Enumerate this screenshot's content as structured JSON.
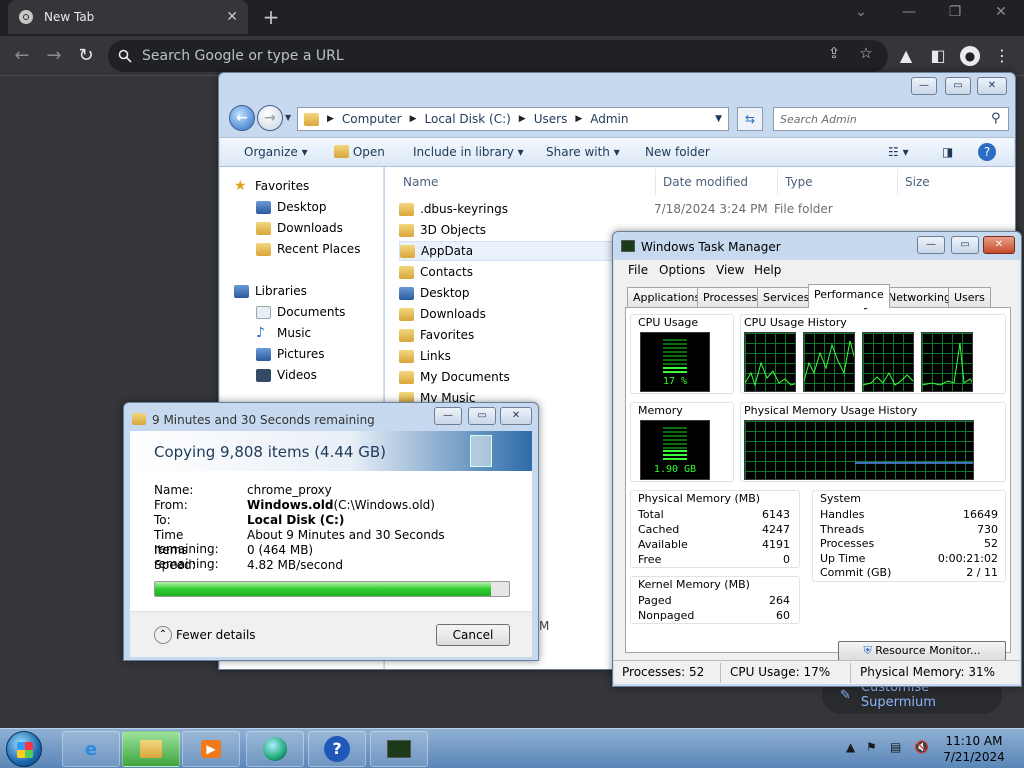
{
  "chrome": {
    "tab_title": "New Tab",
    "omnibox_placeholder": "Search Google or type a URL",
    "customise_label": "Customise Supermium"
  },
  "explorer": {
    "breadcrumb": [
      "Computer",
      "Local Disk (C:)",
      "Users",
      "Admin"
    ],
    "search_placeholder": "Search Admin",
    "commands": {
      "organize": "Organize",
      "open": "Open",
      "include": "Include in library",
      "share": "Share with",
      "new_folder": "New folder"
    },
    "nav": {
      "favorites": "Favorites",
      "fav_items": [
        "Desktop",
        "Downloads",
        "Recent Places"
      ],
      "libraries": "Libraries",
      "lib_items": [
        "Documents",
        "Music",
        "Pictures",
        "Videos"
      ]
    },
    "columns": {
      "name": "Name",
      "date": "Date modified",
      "type": "Type",
      "size": "Size"
    },
    "files": [
      {
        "name": ".dbus-keyrings",
        "date": "7/18/2024 3:24 PM",
        "type": "File folder"
      },
      {
        "name": "3D Objects",
        "date": "",
        "type": ""
      },
      {
        "name": "AppData",
        "date": "",
        "type": ""
      },
      {
        "name": "Contacts",
        "date": "",
        "type": ""
      },
      {
        "name": "Desktop",
        "date": "",
        "type": ""
      },
      {
        "name": "Downloads",
        "date": "",
        "type": ""
      },
      {
        "name": "Favorites",
        "date": "",
        "type": ""
      },
      {
        "name": "Links",
        "date": "",
        "type": ""
      },
      {
        "name": "My Documents",
        "date": "",
        "type": ""
      },
      {
        "name": "My Music",
        "date": "",
        "type": ""
      }
    ],
    "status_fragment": "M"
  },
  "taskmgr": {
    "title": "Windows Task Manager",
    "menu": [
      "File",
      "Options",
      "View",
      "Help"
    ],
    "tabs": [
      "Applications",
      "Processes",
      "Services",
      "Performance",
      "Networking",
      "Users"
    ],
    "active_tab": "Performance",
    "cpu_usage_label": "CPU Usage",
    "cpu_usage_value": "17 %",
    "cpu_usage_pct": 0.17,
    "cpu_history_label": "CPU Usage History",
    "memory_label": "Memory",
    "memory_value": "1.90 GB",
    "memory_pct": 0.31,
    "phys_history_label": "Physical Memory Usage History",
    "physical": {
      "label": "Physical Memory (MB)",
      "rows": [
        {
          "k": "Total",
          "v": "6143"
        },
        {
          "k": "Cached",
          "v": "4247"
        },
        {
          "k": "Available",
          "v": "4191"
        },
        {
          "k": "Free",
          "v": "0"
        }
      ]
    },
    "kernel": {
      "label": "Kernel Memory (MB)",
      "rows": [
        {
          "k": "Paged",
          "v": "264"
        },
        {
          "k": "Nonpaged",
          "v": "60"
        }
      ]
    },
    "system": {
      "label": "System",
      "rows": [
        {
          "k": "Handles",
          "v": "16649"
        },
        {
          "k": "Threads",
          "v": "730"
        },
        {
          "k": "Processes",
          "v": "52"
        },
        {
          "k": "Up Time",
          "v": "0:00:21:02"
        },
        {
          "k": "Commit (GB)",
          "v": "2 / 11"
        }
      ]
    },
    "resource_monitor": "Resource Monitor...",
    "status": {
      "processes": "Processes: 52",
      "cpu": "CPU Usage: 17%",
      "memory": "Physical Memory: 31%"
    }
  },
  "copy": {
    "title": "9 Minutes and 30 Seconds remaining",
    "heading": "Copying 9,808 items (4.44 GB)",
    "name_k": "Name:",
    "name_v": "chrome_proxy",
    "from_k": "From:",
    "from_bold": "Windows.old",
    "from_rest": " (C:\\Windows.old)",
    "to_k": "To:",
    "to_v": "Local Disk (C:)",
    "time_k": "Time remaining:",
    "time_v": "About 9 Minutes and 30 Seconds",
    "items_k": "Items remaining:",
    "items_v": "0 (464 MB)",
    "speed_k": "Speed:",
    "speed_v": "4.82 MB/second",
    "progress": 0.95,
    "fewer": "Fewer details",
    "cancel": "Cancel"
  },
  "taskbar": {
    "time": "11:10 AM",
    "date": "7/21/2024"
  }
}
